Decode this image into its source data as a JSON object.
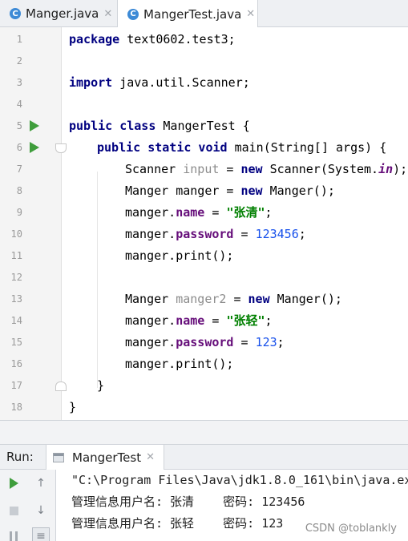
{
  "tabs": [
    {
      "label": "Manger.java",
      "icon": "java-class-icon",
      "active": false
    },
    {
      "label": "MangerTest.java",
      "icon": "java-class-icon",
      "active": true
    }
  ],
  "editor": {
    "line_numbers": [
      "1",
      "2",
      "3",
      "4",
      "5",
      "6",
      "7",
      "8",
      "9",
      "10",
      "11",
      "12",
      "13",
      "14",
      "15",
      "16",
      "17",
      "18"
    ],
    "lines": {
      "l1_kw": "package",
      "l1_rest": " text0602.test3;",
      "l3_kw": "import",
      "l3_rest": " java.util.Scanner;",
      "l5_kw": "public class",
      "l5_rest": " MangerTest {",
      "l6_kw": "public static void",
      "l6_rest": " main(String[] args) {",
      "l7_a": "Scanner ",
      "l7_var": "input",
      "l7_b": " = ",
      "l7_kw": "new",
      "l7_c": " Scanner(System.",
      "l7_fld": "in",
      "l7_d": ");",
      "l8_a": "Manger manger = ",
      "l8_kw": "new",
      "l8_b": " Manger();",
      "l9_a": "manger.",
      "l9_fld": "name",
      "l9_b": " = ",
      "l9_str": "\"张清\"",
      "l9_c": ";",
      "l10_a": "manger.",
      "l10_fld": "password",
      "l10_b": " = ",
      "l10_num": "123456",
      "l10_c": ";",
      "l11": "manger.print();",
      "l13_a": "Manger ",
      "l13_var": "manger2",
      "l13_b": " = ",
      "l13_kw": "new",
      "l13_c": " Manger();",
      "l14_a": "manger.",
      "l14_fld": "name",
      "l14_b": " = ",
      "l14_str": "\"张轻\"",
      "l14_c": ";",
      "l15_a": "manger.",
      "l15_fld": "password",
      "l15_b": " = ",
      "l15_num": "123",
      "l15_c": ";",
      "l16": "manger.print();",
      "l17": "}",
      "l18": "}"
    }
  },
  "run_panel": {
    "label": "Run:",
    "tab_label": "MangerTest",
    "output": [
      "\"C:\\Program Files\\Java\\jdk1.8.0_161\\bin\\java.exe",
      "管理信息用户名: 张清    密码: 123456",
      "管理信息用户名: 张轻    密码: 123"
    ]
  },
  "watermark": "CSDN @toblankly",
  "colors": {
    "keyword": "#000080",
    "string": "#008000",
    "number": "#1750eb",
    "field": "#660e7a",
    "run_green": "#3f9d3c"
  }
}
